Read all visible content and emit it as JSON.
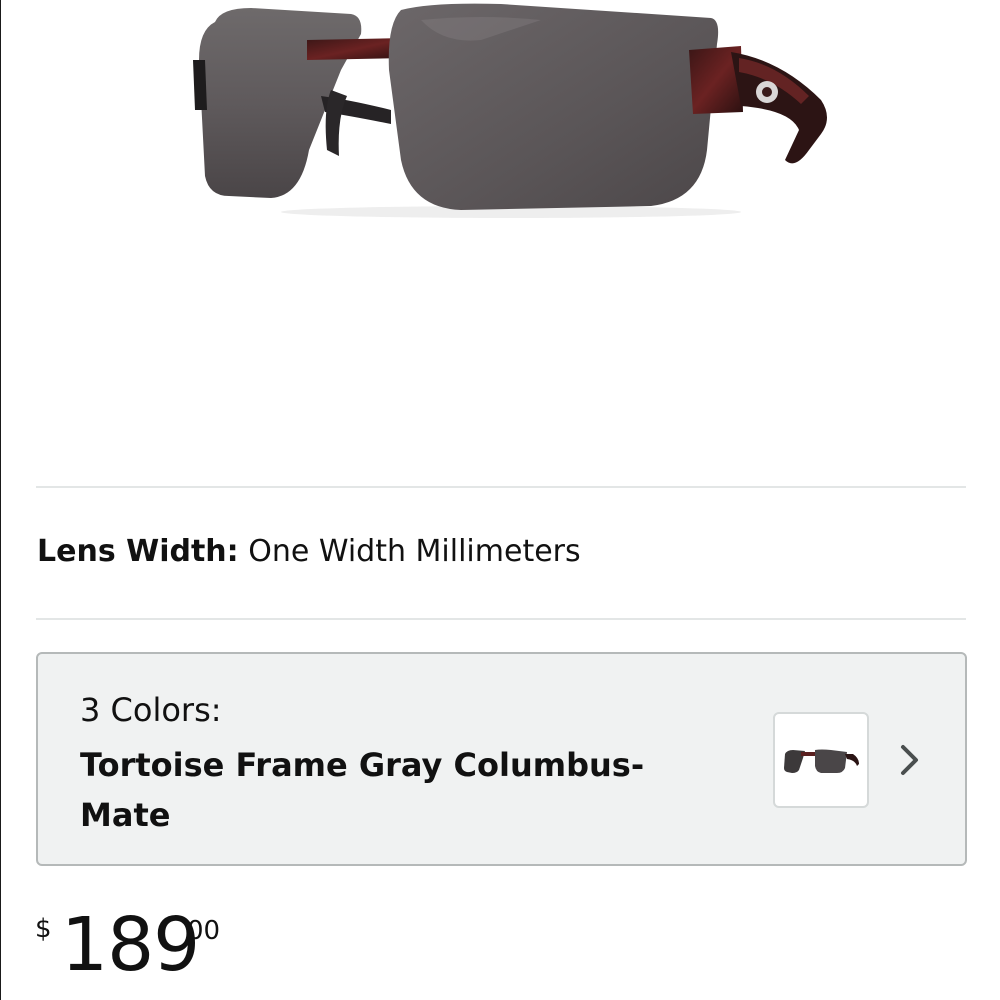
{
  "product": {
    "image_icon": "sunglasses-icon"
  },
  "lens_width": {
    "label": "Lens Width:",
    "value": "One Width Millimeters"
  },
  "color_selector": {
    "count_label": "3 Colors:",
    "selected_name": "Tortoise Frame Gray Columbus-Mate",
    "swatch_icon": "sunglasses-thumbnail-icon",
    "chevron_icon": "chevron-right-icon"
  },
  "price": {
    "currency": "$",
    "whole": "189",
    "fraction": "00"
  },
  "colors": {
    "card_background": "#f0f2f2",
    "card_border": "#b5b9b9",
    "divider": "#e3e6e6",
    "text": "#111111"
  }
}
